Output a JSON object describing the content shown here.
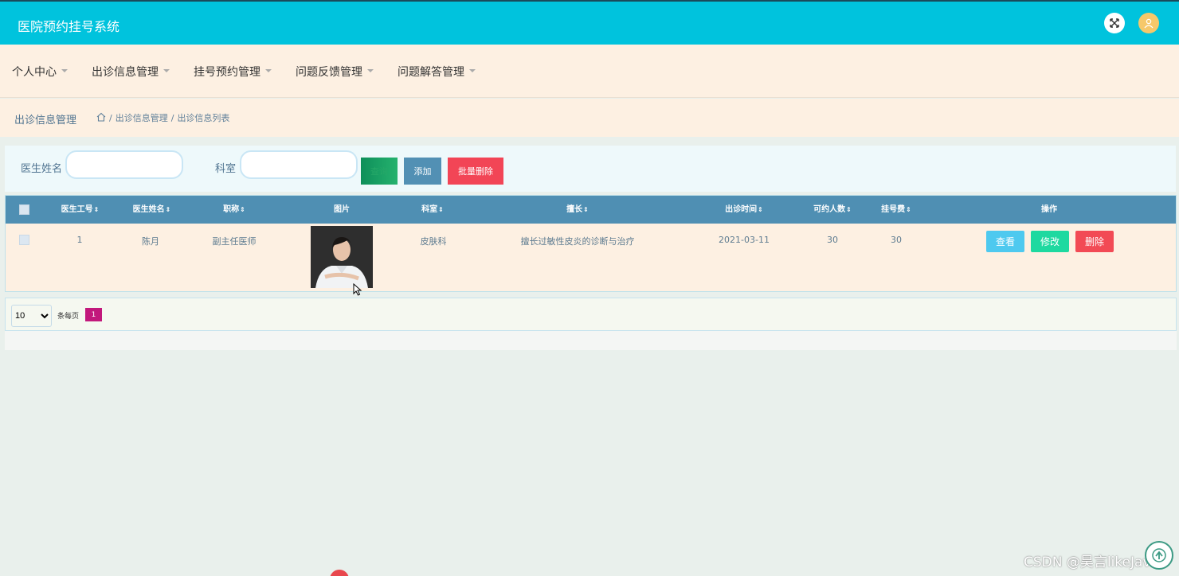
{
  "header": {
    "title": "医院预约挂号系统",
    "icons": [
      "fullscreen-icon",
      "user-icon"
    ],
    "accent_color": "#00c3dd"
  },
  "menu": {
    "items": [
      {
        "label": "个人中心"
      },
      {
        "label": "出诊信息管理"
      },
      {
        "label": "挂号预约管理"
      },
      {
        "label": "问题反馈管理"
      },
      {
        "label": "问题解答管理"
      }
    ]
  },
  "breadcrumb": {
    "title": "出诊信息管理",
    "separator": "/",
    "items": [
      "出诊信息管理",
      "出诊信息列表"
    ]
  },
  "search": {
    "doctor_name_label": "医生姓名",
    "doctor_name_value": "",
    "department_label": "科室",
    "department_value": "",
    "search_button": "查询",
    "add_button": "添加",
    "batch_delete_button": "批量删除"
  },
  "table": {
    "columns": [
      "医生工号",
      "医生姓名",
      "职称",
      "图片",
      "科室",
      "擅长",
      "出诊时间",
      "可约人数",
      "挂号费",
      "操作"
    ],
    "rows": [
      {
        "doctor_id": "1",
        "doctor_name": "陈月",
        "title": "副主任医师",
        "department": "皮肤科",
        "specialty": "擅长过敏性皮炎的诊断与治疗",
        "visit_date": "2021-03-11",
        "available": "30",
        "fee": "30",
        "actions": {
          "view": "查看",
          "edit": "修改",
          "delete": "删除"
        }
      }
    ],
    "header_color": "#4f8fb3"
  },
  "pagination": {
    "page_size": "10",
    "page_size_options": [
      "10"
    ],
    "per_page_label": "条每页",
    "current_page": "1"
  },
  "watermark": "CSDN @昊言likeJava"
}
